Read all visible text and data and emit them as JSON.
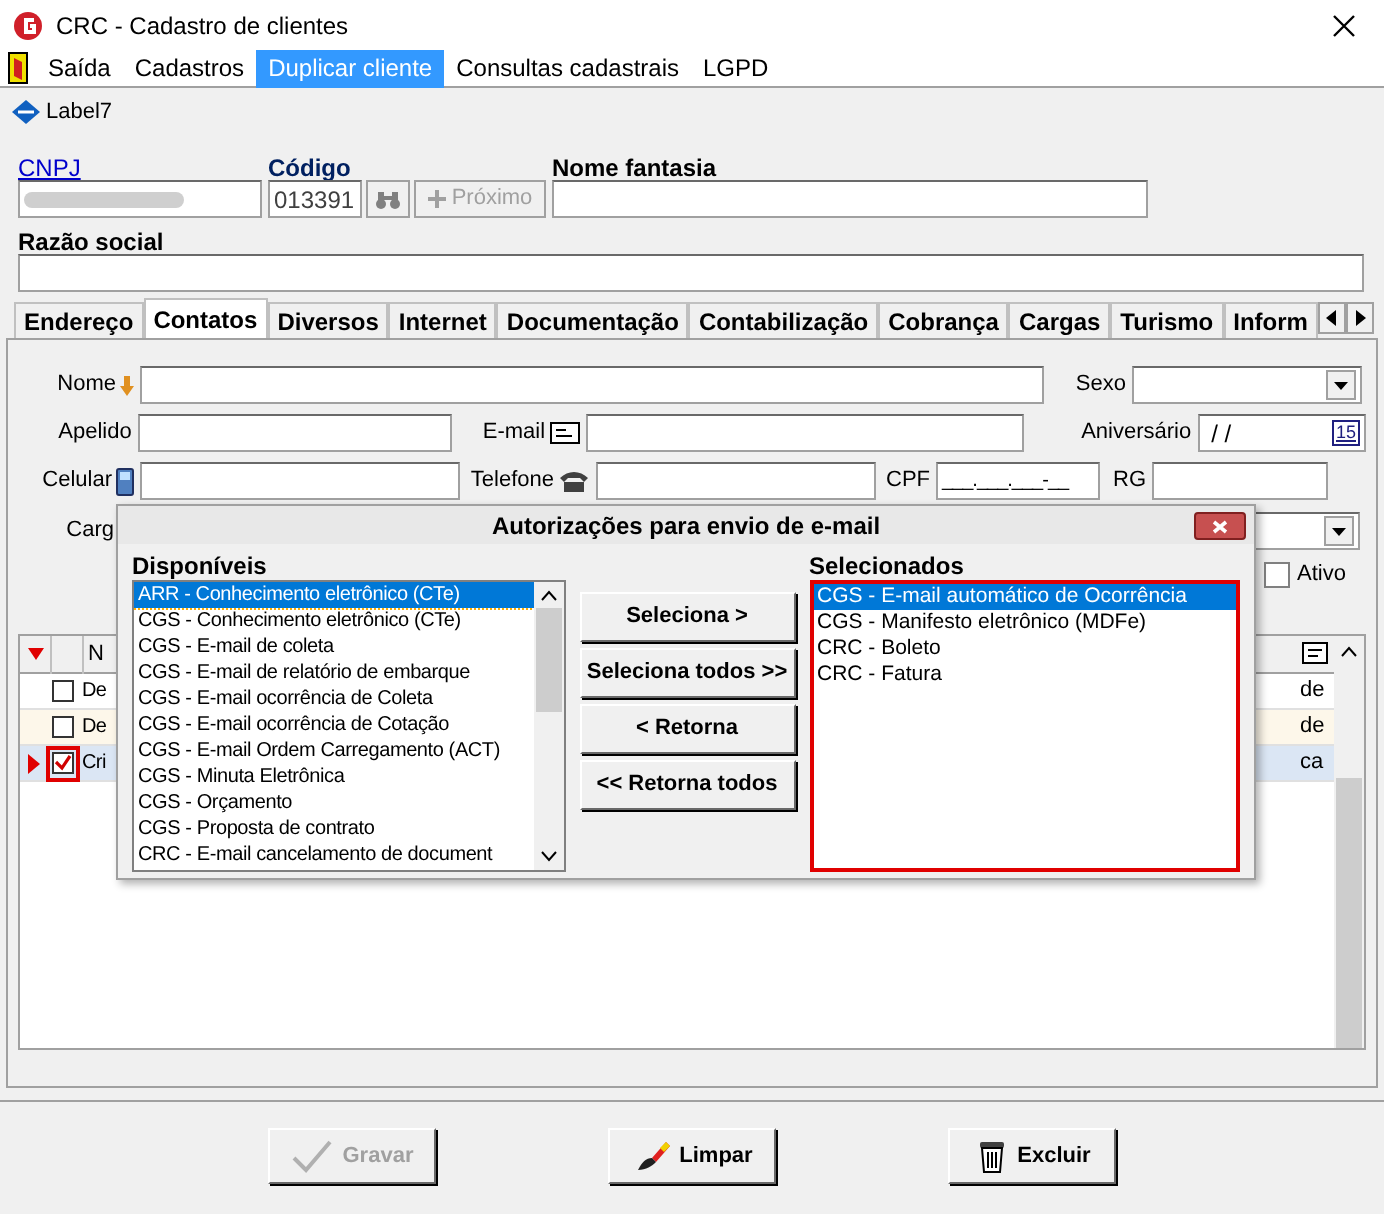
{
  "window": {
    "title": "CRC - Cadastro de clientes"
  },
  "menu": [
    {
      "label": "Saída",
      "selected": false
    },
    {
      "label": "Cadastros",
      "selected": false
    },
    {
      "label": "Duplicar cliente",
      "selected": true
    },
    {
      "label": "Consultas cadastrais",
      "selected": false
    },
    {
      "label": "LGPD",
      "selected": false
    }
  ],
  "header_label": "Label7",
  "cnpj": {
    "label": "CNPJ"
  },
  "codigo": {
    "label": "Código",
    "value": "013391"
  },
  "proximo_button": {
    "label": "Próximo",
    "disabled": true
  },
  "nome_fantasia": {
    "label": "Nome fantasia"
  },
  "razao_social": {
    "label": "Razão social"
  },
  "tabs": [
    {
      "label": "Endereço",
      "selected": false
    },
    {
      "label": "Contatos",
      "selected": true
    },
    {
      "label": "Diversos",
      "selected": false
    },
    {
      "label": "Internet",
      "selected": false
    },
    {
      "label": "Documentação",
      "selected": false
    },
    {
      "label": "Contabilização",
      "selected": false
    },
    {
      "label": "Cobrança",
      "selected": false
    },
    {
      "label": "Cargas",
      "selected": false
    },
    {
      "label": "Turismo",
      "selected": false
    },
    {
      "label": "Inform",
      "selected": false
    }
  ],
  "form": {
    "nome": "Nome",
    "sexo": "Sexo",
    "apelido": "Apelido",
    "email": "E-mail",
    "aniversario": {
      "label": "Aniversário",
      "value": "/ /",
      "calendar": "15"
    },
    "celular": "Celular",
    "telefone": "Telefone",
    "cpf": {
      "label": "CPF",
      "value": "___.___.___-__"
    },
    "rg": "RG",
    "cargo": "Carg",
    "ativo": {
      "label": "Ativo",
      "checked": false
    }
  },
  "grid": {
    "header": "N",
    "rows": [
      {
        "col_2": "De",
        "col_last": "de",
        "checked": false,
        "selected": false,
        "outlined": false
      },
      {
        "col_2": "De",
        "col_last": "de",
        "checked": false,
        "selected": false,
        "outlined": false
      },
      {
        "col_2": "Cri",
        "col_last": "ca",
        "checked": true,
        "selected": true,
        "outlined": true
      }
    ]
  },
  "dialog": {
    "title": "Autorizações para envio de e-mail",
    "available": {
      "label": "Disponíveis",
      "items": [
        {
          "label": "ARR - Conhecimento eletrônico (CTe)",
          "selected": true
        },
        {
          "label": "CGS - Conhecimento eletrônico (CTe)",
          "selected": false
        },
        {
          "label": "CGS - E-mail de coleta",
          "selected": false
        },
        {
          "label": "CGS - E-mail de relatório de embarque",
          "selected": false
        },
        {
          "label": "CGS - E-mail ocorrência de Coleta",
          "selected": false
        },
        {
          "label": "CGS - E-mail ocorrência de Cotação",
          "selected": false
        },
        {
          "label": "CGS - E-mail Ordem Carregamento (ACT)",
          "selected": false
        },
        {
          "label": "CGS - Minuta Eletrônica",
          "selected": false
        },
        {
          "label": "CGS - Orçamento",
          "selected": false
        },
        {
          "label": "CGS - Proposta de contrato",
          "selected": false
        },
        {
          "label": "CRC - E-mail cancelamento de document",
          "selected": false
        }
      ]
    },
    "buttons": [
      "Seleciona >",
      "Seleciona todos >>",
      "< Retorna",
      "<< Retorna todos"
    ],
    "chosen": {
      "label": "Selecionados",
      "items": [
        {
          "label": "CGS - E-mail automático de Ocorrência",
          "selected": true
        },
        {
          "label": "CGS - Manifesto eletrônico (MDFe)",
          "selected": false
        },
        {
          "label": "CRC - Boleto",
          "selected": false
        },
        {
          "label": "CRC - Fatura",
          "selected": false
        }
      ]
    }
  },
  "footer_buttons": [
    {
      "kind": "save",
      "label": "Gravar",
      "disabled": true
    },
    {
      "kind": "clear",
      "label": "Limpar",
      "disabled": false
    },
    {
      "kind": "delete",
      "label": "Excluir",
      "disabled": false
    }
  ]
}
